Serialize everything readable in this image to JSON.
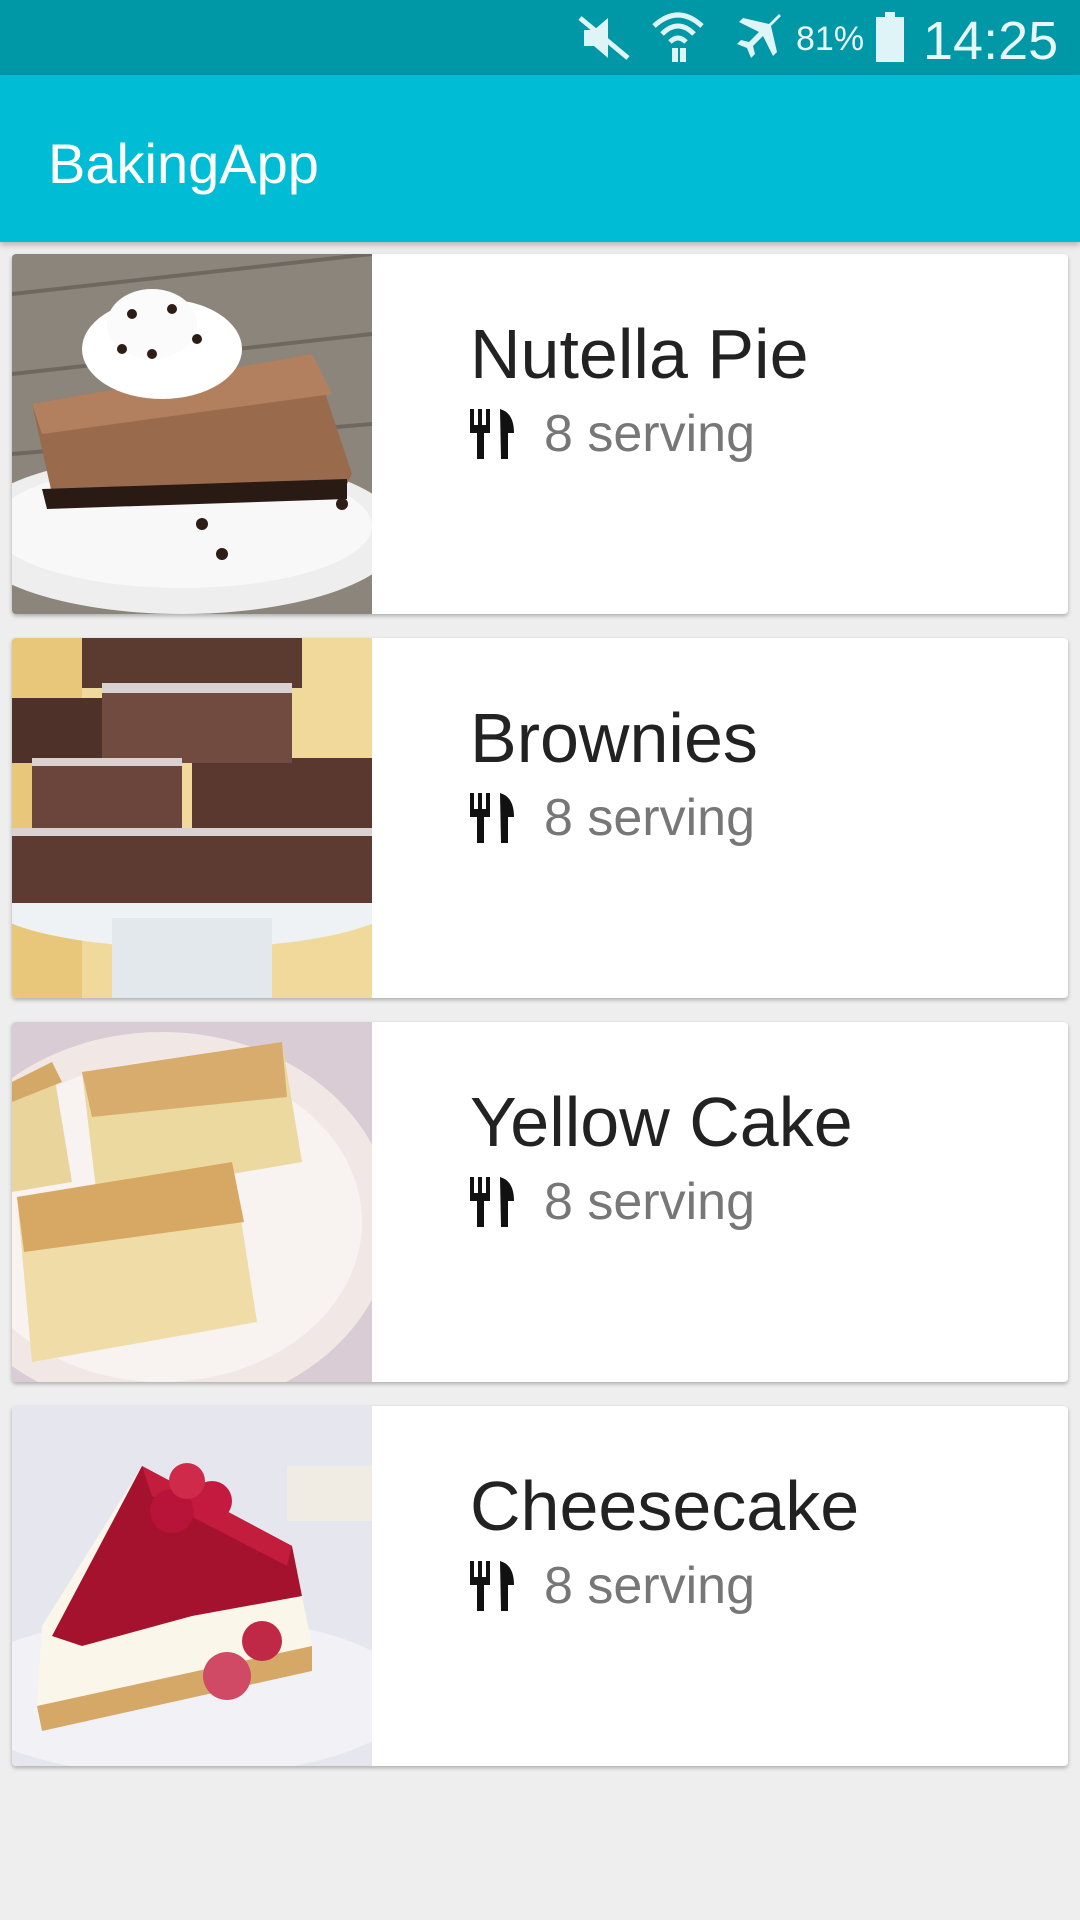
{
  "status_bar": {
    "battery_percent": "81%",
    "time": "14:25",
    "icons": [
      "mute-icon",
      "wifi-icon",
      "airplane-mode-icon",
      "battery-icon"
    ]
  },
  "app_bar": {
    "title": "BakingApp",
    "color": "#00bcd4"
  },
  "recipes": [
    {
      "name": "Nutella Pie",
      "servings": "8 serving",
      "image": "nutella-pie-image"
    },
    {
      "name": "Brownies",
      "servings": "8 serving",
      "image": "brownies-image"
    },
    {
      "name": "Yellow Cake",
      "servings": "8 serving",
      "image": "yellow-cake-image"
    },
    {
      "name": "Cheesecake",
      "servings": "8 serving",
      "image": "cheesecake-image"
    }
  ],
  "colors": {
    "status_bar": "#0097a7",
    "background": "#eeeeee"
  }
}
